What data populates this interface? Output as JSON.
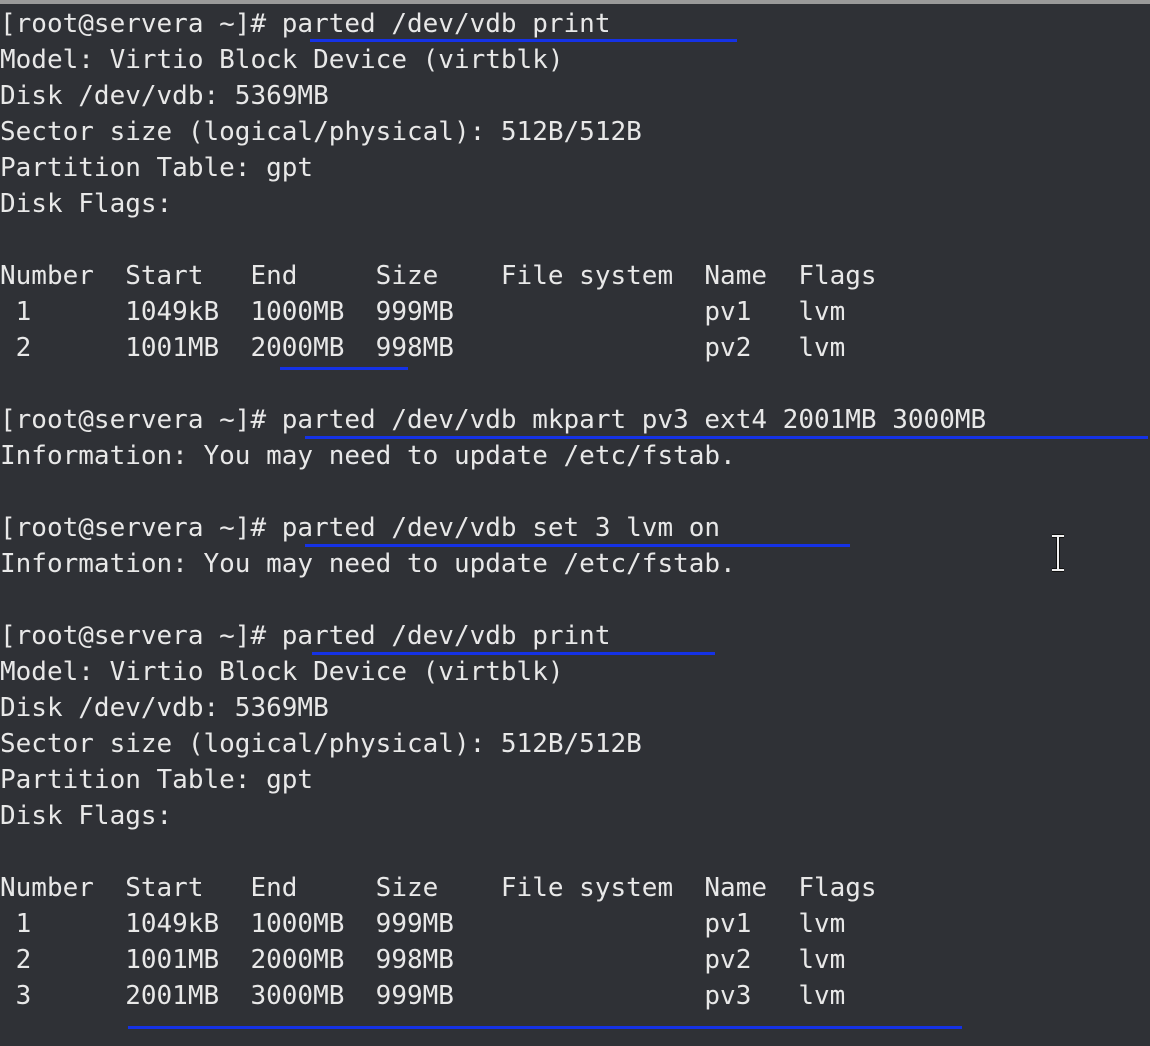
{
  "terminal": {
    "lines": [
      "[root@servera ~]# parted /dev/vdb print",
      "Model: Virtio Block Device (virtblk)",
      "Disk /dev/vdb: 5369MB",
      "Sector size (logical/physical): 512B/512B",
      "Partition Table: gpt",
      "Disk Flags:",
      "",
      "Number  Start   End     Size    File system  Name  Flags",
      " 1      1049kB  1000MB  999MB                pv1   lvm",
      " 2      1001MB  2000MB  998MB                pv2   lvm",
      "",
      "[root@servera ~]# parted /dev/vdb mkpart pv3 ext4 2001MB 3000MB",
      "Information: You may need to update /etc/fstab.",
      "",
      "[root@servera ~]# parted /dev/vdb set 3 lvm on",
      "Information: You may need to update /etc/fstab.",
      "",
      "[root@servera ~]# parted /dev/vdb print",
      "Model: Virtio Block Device (virtblk)",
      "Disk /dev/vdb: 5369MB",
      "Sector size (logical/physical): 512B/512B",
      "Partition Table: gpt",
      "Disk Flags:",
      "",
      "Number  Start   End     Size    File system  Name  Flags",
      " 1      1049kB  1000MB  999MB                pv1   lvm",
      " 2      1001MB  2000MB  998MB                pv2   lvm",
      " 3      2001MB  3000MB  999MB                pv3   lvm"
    ]
  },
  "colors": {
    "background": "#2f3136",
    "text": "#e8e8e8",
    "annotation_underline": "#1532e6"
  },
  "icons": {
    "cursor": "text-cursor-ibeam-icon"
  }
}
